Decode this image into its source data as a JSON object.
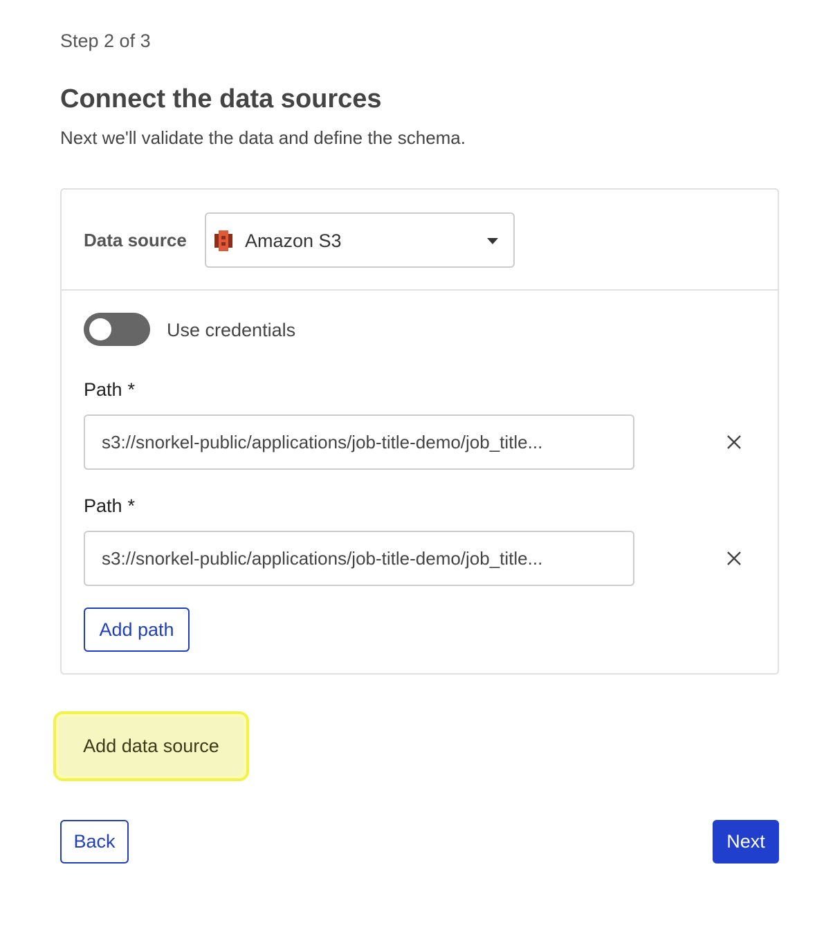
{
  "wizard": {
    "step_text": "Step 2 of 3",
    "title": "Connect the data sources",
    "subtitle": "Next we'll validate the data and define the schema."
  },
  "data_source": {
    "label": "Data source",
    "selected": "Amazon S3",
    "icon": "amazon-s3-icon",
    "icon_colors": {
      "dark": "#8c2d1c",
      "light": "#e05a3a"
    }
  },
  "credentials": {
    "label": "Use credentials",
    "enabled": false
  },
  "paths": [
    {
      "label": "Path",
      "required_mark": "*",
      "value": "s3://snorkel-public/applications/job-title-demo/job_title..."
    },
    {
      "label": "Path",
      "required_mark": "*",
      "value": "s3://snorkel-public/applications/job-title-demo/job_title..."
    }
  ],
  "actions": {
    "add_path": "Add path",
    "add_data_source": "Add data source",
    "back": "Back",
    "next": "Next"
  },
  "colors": {
    "primary": "#1f3fcc",
    "highlight": "#f2f24a",
    "toggle_off": "#666666"
  }
}
